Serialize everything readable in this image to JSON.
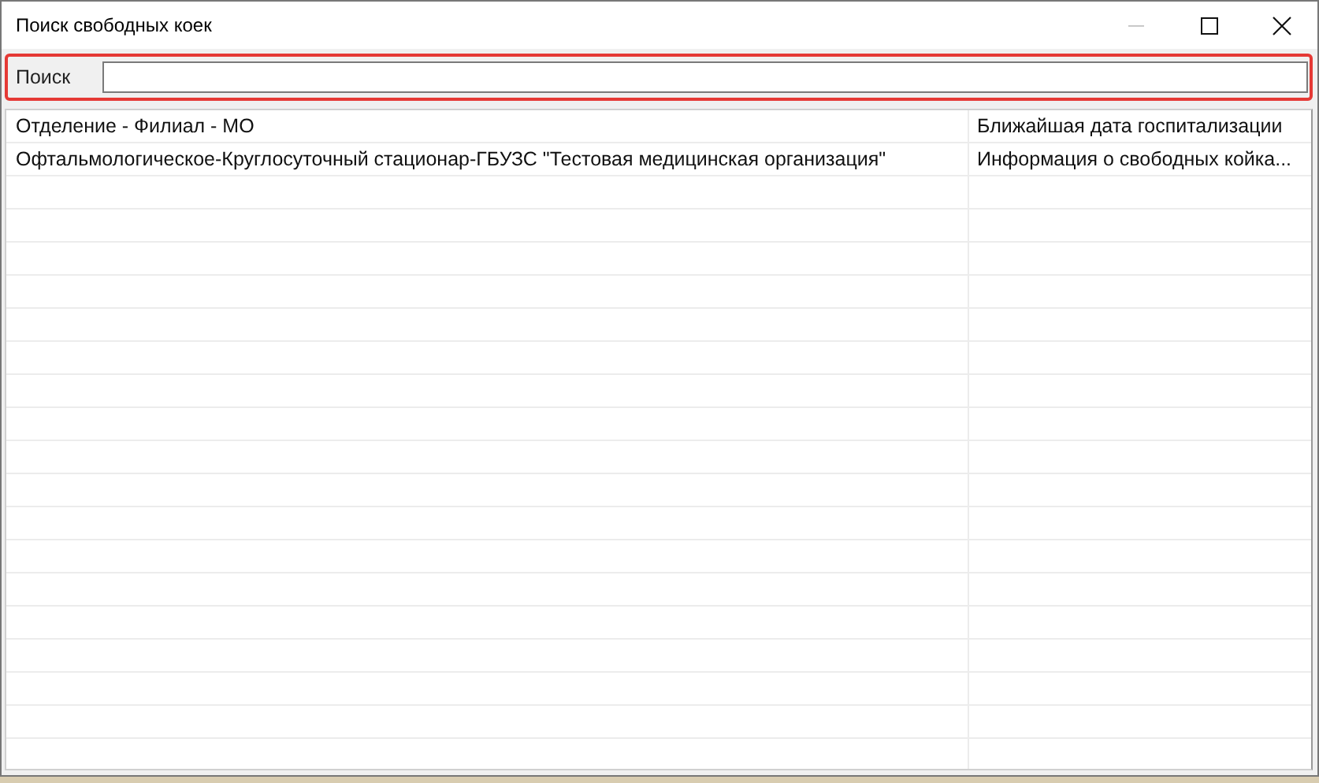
{
  "window": {
    "title": "Поиск свободных коек"
  },
  "search": {
    "label": "Поиск",
    "focused": true
  },
  "table": {
    "columns": [
      "Отделение - Филиал - МО",
      "Ближайшая дата госпитализации"
    ],
    "rows": [
      [
        "Офтальмологическое-Круглосуточный стационар-ГБУЗС \"Тестовая медицинская организация\"",
        "Информация о свободных койка..."
      ]
    ]
  }
}
